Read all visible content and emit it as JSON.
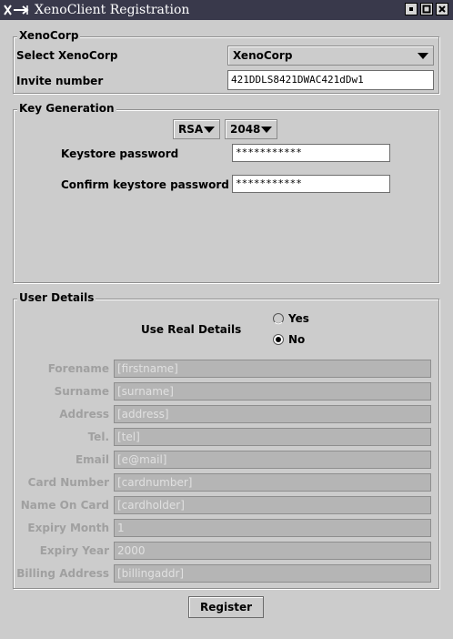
{
  "window": {
    "title": "XenoClient Registration",
    "icon": "xeno-app-icon",
    "controls": [
      "minimize-icon",
      "maximize-icon",
      "close-icon"
    ]
  },
  "xenocorp_group": {
    "title": "XenoCorp",
    "select_label": "Select XenoCorp",
    "select_value": "XenoCorp",
    "invite_label": "Invite number",
    "invite_value": "421DDLS8421DWAC421dDw1"
  },
  "key_group": {
    "title": "Key Generation",
    "algorithm": "RSA",
    "key_size": "2048",
    "password_label": "Keystore password",
    "password_value": "***********",
    "confirm_label": "Confirm keystore password",
    "confirm_value": "***********"
  },
  "user_group": {
    "title": "User Details",
    "real_details_label": "Use Real Details",
    "option_yes": "Yes",
    "option_no": "No",
    "selected_option": "No",
    "fields": [
      {
        "label": "Forename",
        "value": "[firstname]"
      },
      {
        "label": "Surname",
        "value": "[surname]"
      },
      {
        "label": "Address",
        "value": "[address]"
      },
      {
        "label": "Tel.",
        "value": "[tel]"
      },
      {
        "label": "Email",
        "value": "[e@mail]"
      },
      {
        "label": "Card Number",
        "value": "[cardnumber]"
      },
      {
        "label": "Name On Card",
        "value": "[cardholder]"
      },
      {
        "label": "Expiry Month",
        "value": "1"
      },
      {
        "label": "Expiry Year",
        "value": "2000"
      },
      {
        "label": "Billing Address",
        "value": "[billingaddr]"
      }
    ]
  },
  "register_label": "Register",
  "colors": {
    "titlebar": "#39394b",
    "window_bg": "#cccccc",
    "disabled_field": "#b5b5b5",
    "disabled_text": "#a0a0a0"
  }
}
